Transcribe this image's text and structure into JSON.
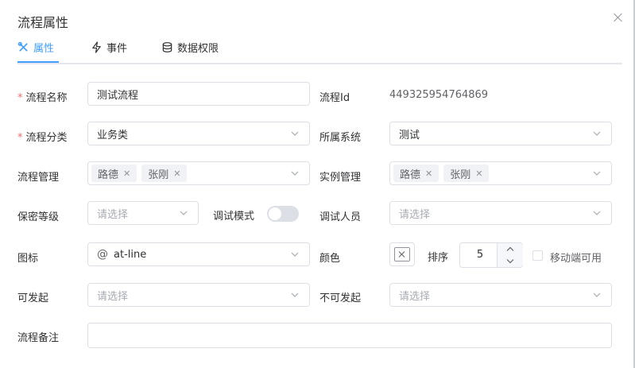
{
  "dialog": {
    "title": "流程属性"
  },
  "tabs": [
    {
      "label": "属性",
      "icon": "tools-icon",
      "active": true
    },
    {
      "label": "事件",
      "icon": "lightning-icon",
      "active": false
    },
    {
      "label": "数据权限",
      "icon": "database-icon",
      "active": false
    }
  ],
  "form": {
    "process_name": {
      "label": "流程名称",
      "value": "测试流程",
      "required": true
    },
    "process_id": {
      "label": "流程Id",
      "value": "449325954764869"
    },
    "process_category": {
      "label": "流程分类",
      "value": "业务类",
      "required": true
    },
    "system": {
      "label": "所属系统",
      "value": "测试"
    },
    "process_admin": {
      "label": "流程管理",
      "tags": [
        "路德",
        "张刚"
      ]
    },
    "instance_admin": {
      "label": "实例管理",
      "tags": [
        "路德",
        "张刚"
      ]
    },
    "secrecy": {
      "label": "保密等级",
      "placeholder": "请选择"
    },
    "debug_mode": {
      "label": "调试模式",
      "enabled": false
    },
    "debug_users": {
      "label": "调试人员",
      "placeholder": "请选择"
    },
    "icon_field": {
      "label": "图标",
      "value": "at-line"
    },
    "color": {
      "label": "颜色"
    },
    "sort": {
      "label": "排序",
      "value": "5"
    },
    "mobile": {
      "label": "移动端可用",
      "checked": false
    },
    "can_start": {
      "label": "可发起",
      "placeholder": "请选择"
    },
    "cannot_start": {
      "label": "不可发起",
      "placeholder": "请选择"
    },
    "remark": {
      "label": "流程备注",
      "value": ""
    }
  },
  "colors": {
    "accent": "#409eff",
    "required": "#f56c6c",
    "border": "#dcdfe6"
  }
}
